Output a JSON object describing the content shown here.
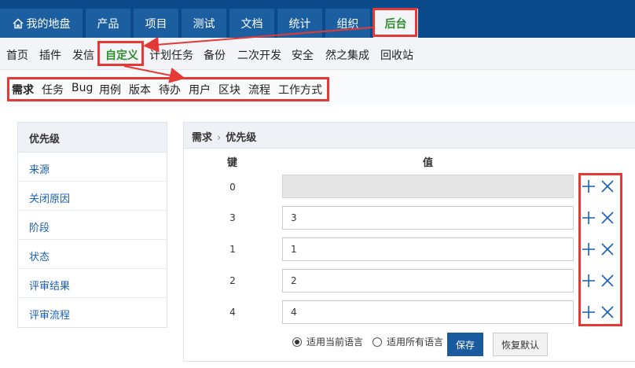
{
  "topnav": {
    "tabs": [
      {
        "label": "我的地盘",
        "icon": "home-icon"
      },
      {
        "label": "产品"
      },
      {
        "label": "项目"
      },
      {
        "label": "测试"
      },
      {
        "label": "文档"
      },
      {
        "label": "统计"
      },
      {
        "label": "组织"
      },
      {
        "label": "后台",
        "active": true
      }
    ]
  },
  "subnav": {
    "items": [
      "首页",
      "插件",
      "发信",
      "自定义",
      "计划任务",
      "备份",
      "二次开发",
      "安全",
      "然之集成",
      "回收站"
    ],
    "active": "自定义"
  },
  "thirdnav": {
    "items": [
      "需求",
      "任务",
      "Bug",
      "用例",
      "版本",
      "待办",
      "用户",
      "区块",
      "流程",
      "工作方式"
    ],
    "active": "需求"
  },
  "sidemenu": {
    "header": "优先级",
    "items": [
      "来源",
      "关闭原因",
      "阶段",
      "状态",
      "评审结果",
      "评审流程"
    ]
  },
  "panel": {
    "breadcrumb_parent": "需求",
    "breadcrumb_sep": "›",
    "breadcrumb_current": "优先级",
    "col_key": "键",
    "col_value": "值",
    "rows": [
      {
        "key": "0",
        "value": "",
        "disabled": true
      },
      {
        "key": "3",
        "value": "3"
      },
      {
        "key": "1",
        "value": "1"
      },
      {
        "key": "2",
        "value": "2"
      },
      {
        "key": "4",
        "value": "4"
      }
    ],
    "lang_current": "适用当前语言",
    "lang_all": "适用所有语言",
    "lang_selected": "current",
    "save_label": "保存",
    "reset_label": "恢复默认"
  },
  "colors": {
    "topnav_bg": "#0b4a8a",
    "tab_bg": "#1c5fa0",
    "active_green": "#2e8b2e",
    "link_blue": "#1a5fb4",
    "highlight_red": "#e53935"
  }
}
